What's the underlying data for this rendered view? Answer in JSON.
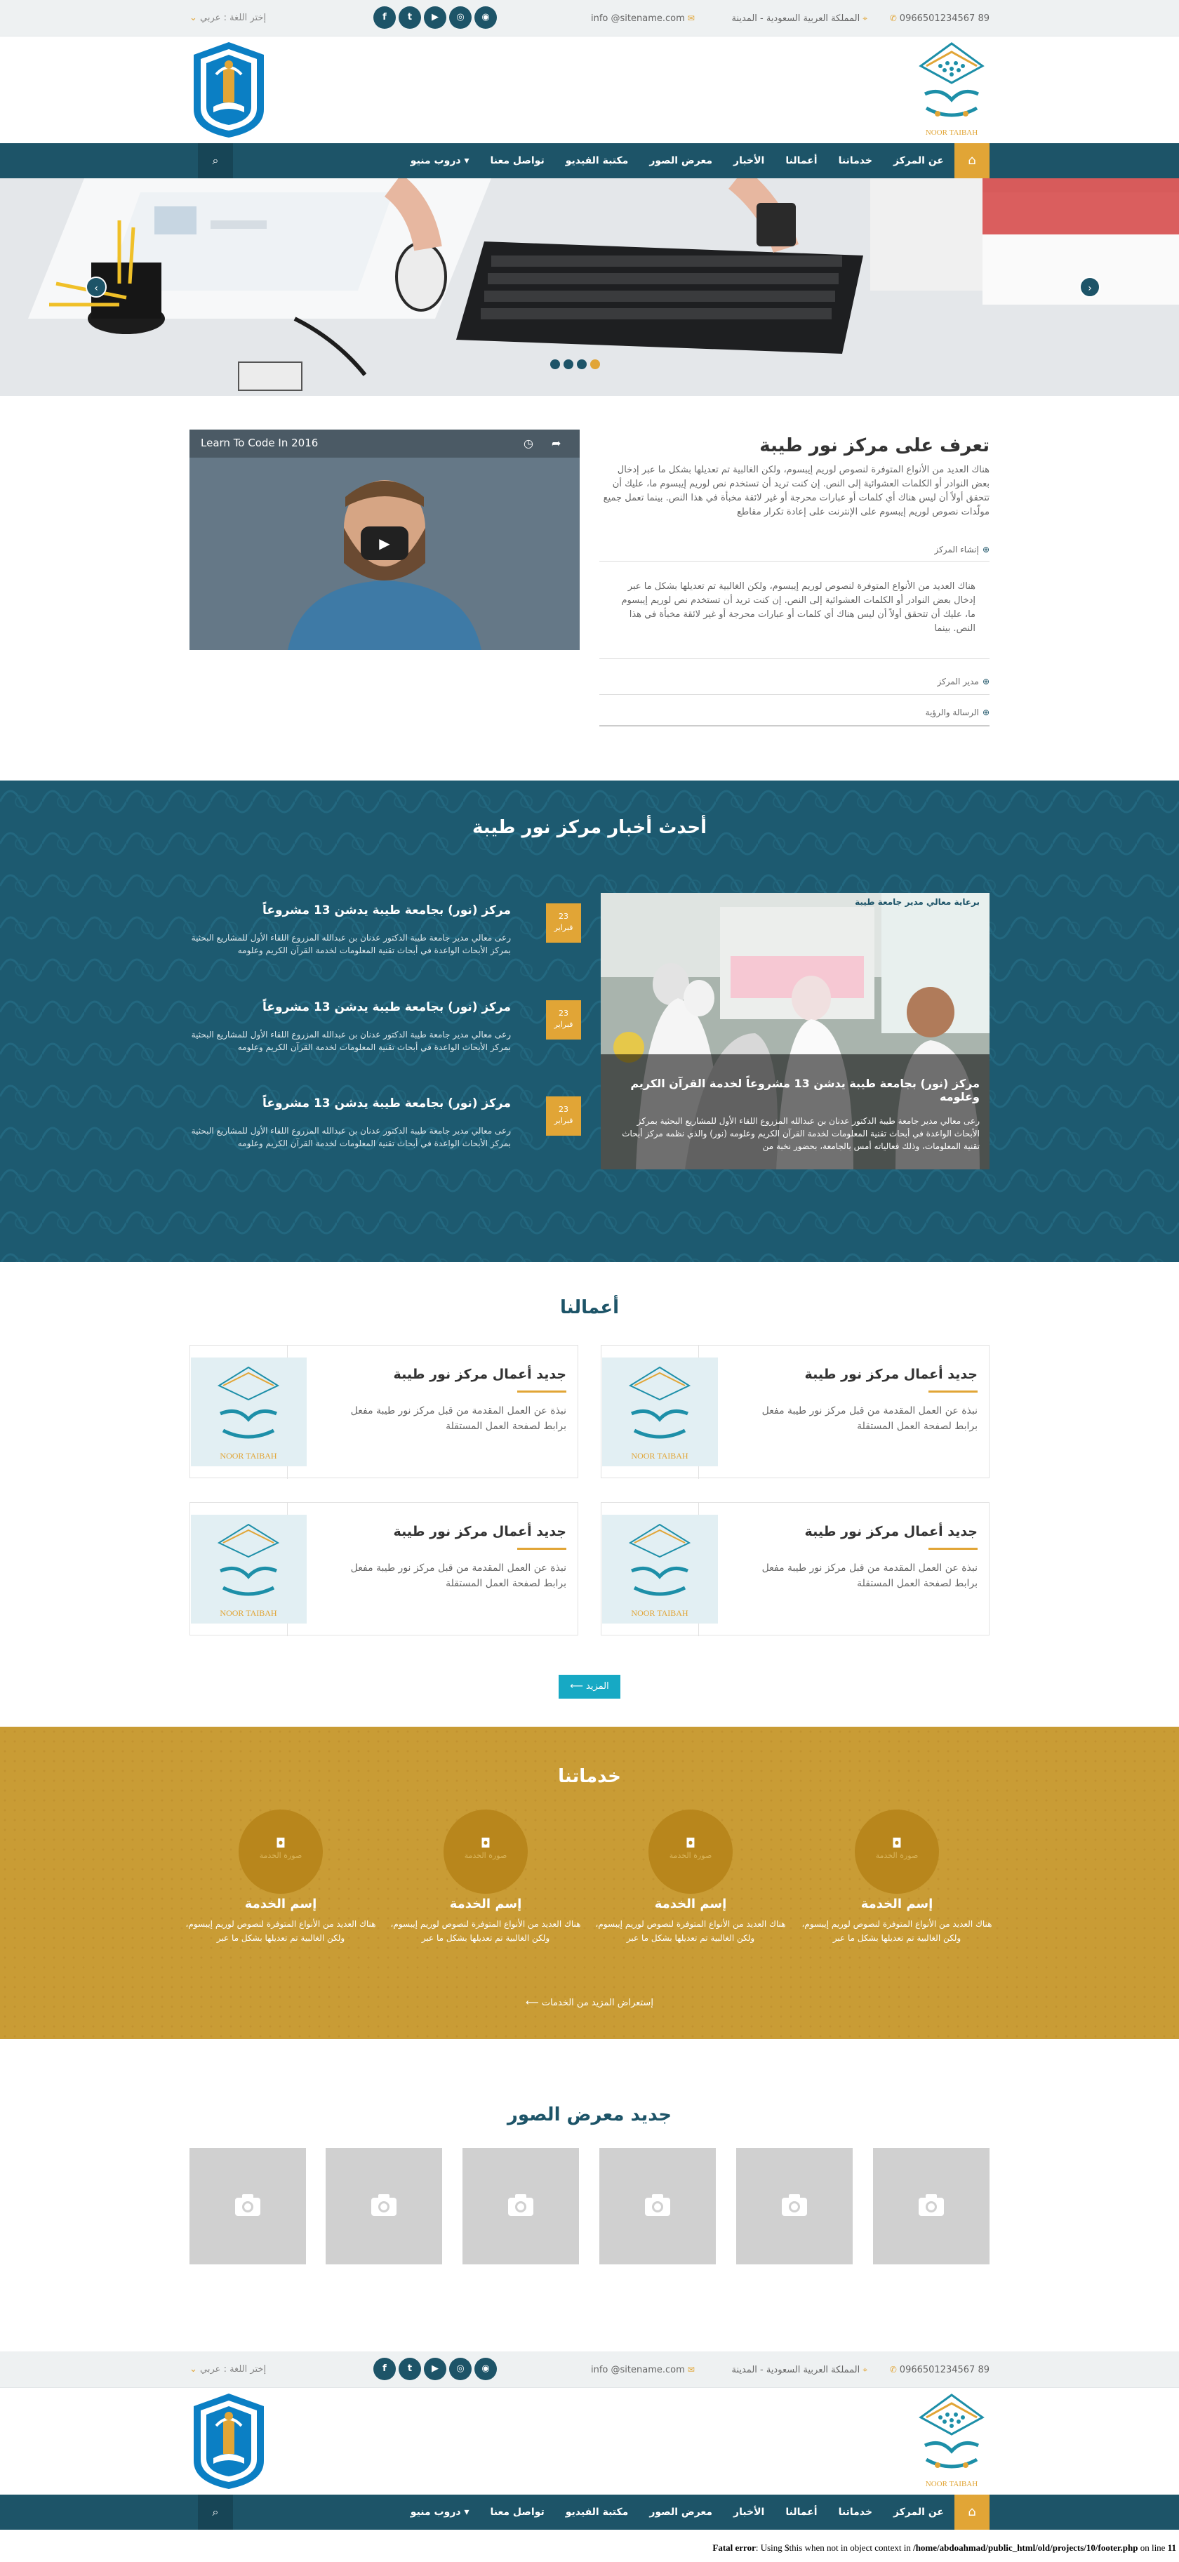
{
  "topbar": {
    "phone": "0966501234567 89",
    "address": "المملكة العربية السعودية - المدينة",
    "email": "info @sitename.com",
    "language_label": "إختر اللغة : عربي"
  },
  "social_icons": [
    "rss-icon",
    "instagram-icon",
    "youtube-icon",
    "twitter-icon",
    "facebook-icon"
  ],
  "logos": {
    "right_logo_text": "نور طيبة",
    "right_logo_caption": "NOOR TAIBAH"
  },
  "nav": {
    "items": [
      "عن المركز",
      "خدماتنا",
      "أعمالنا",
      "الأخبار",
      "معرض الصور",
      "مكتبة الفيديو",
      "تواصل معنا",
      "دروب منيو"
    ]
  },
  "about": {
    "title": "تعرف على مركز نور طيبة",
    "text": "هناك العديد من الأنواع المتوفرة لنصوص لوريم إيبسوم، ولكن الغالبية تم تعديلها بشكل ما عبر إدخال بعض النوادر أو الكلمات العشوائية إلى النص. إن كنت تريد أن تستخدم نص لوريم إيبسوم ما، عليك أن تتحقق أولاً أن ليس هناك أي كلمات أو عبارات محرجة أو غير لائقة مخبأة في هذا النص. بينما تعمل جميع مولّدات نصوص لوريم إيبسوم على الإنترنت على إعادة تكرار مقاطع",
    "accordion": [
      {
        "label": "إنشاء المركز",
        "content": "هناك العديد من الأنواع المتوفرة لنصوص لوريم إيبسوم، ولكن الغالبية تم تعديلها بشكل ما عبر إدخال بعض النوادر أو الكلمات العشوائية إلى النص. إن كنت تريد أن تستخدم نص لوريم إيبسوم ما، عليك أن تتحقق أولاً أن ليس هناك أي كلمات أو عبارات محرجة أو غير لائقة مخبأة في هذا النص. بينما"
      },
      {
        "label": "مدير المركز"
      },
      {
        "label": "الرسالة والرؤية"
      }
    ],
    "video_title": "Learn To Code In 2016"
  },
  "news": {
    "title": "أحدث أخبار مركز نور طيبة",
    "featured": {
      "title": "مركز (نور) بجامعة طيبة يدشن 13 مشروعاً لخدمة القرآن الكريم وعلومه",
      "text": "رعى معالي مدير جامعة طيبة الدكتور عدنان بن عبدالله المزروع اللقاء الأول للمشاريع البحثية بمركز الأبحاث الواعدة في أبحاث تقنية المعلومات لخدمة القرآن الكريم وعلومه (نور) والذي نظمه مركز أبحاث تقنية المعلومات، وذلك فعالياته أمس بالجامعة، بحضور نخبة من",
      "banner": "برعاية معالي مدير جامعة طيبة"
    },
    "items": [
      {
        "day": "23",
        "month": "فبراير",
        "title": "مركز (نور) بجامعة طيبة يدشن 13 مشروعاً",
        "text": "رعى معالي مدير جامعة طيبة الدكتور عدنان بن عبدالله المزروع اللقاء الأول للمشاريع البحثية بمركز الأبحاث الواعدة في أبحاث تقنية المعلومات لخدمة القرآن الكريم وعلومه"
      },
      {
        "day": "23",
        "month": "فبراير",
        "title": "مركز (نور) بجامعة طيبة يدشن 13 مشروعاً",
        "text": "رعى معالي مدير جامعة طيبة الدكتور عدنان بن عبدالله المزروع اللقاء الأول للمشاريع البحثية بمركز الأبحاث الواعدة في أبحاث تقنية المعلومات لخدمة القرآن الكريم وعلومه"
      },
      {
        "day": "23",
        "month": "فبراير",
        "title": "مركز (نور) بجامعة طيبة يدشن 13 مشروعاً",
        "text": "رعى معالي مدير جامعة طيبة الدكتور عدنان بن عبدالله المزروع اللقاء الأول للمشاريع البحثية بمركز الأبحاث الواعدة في أبحاث تقنية المعلومات لخدمة القرآن الكريم وعلومه"
      }
    ]
  },
  "works": {
    "title": "أعمالنا",
    "items": [
      {
        "title": "جديد أعمال مركز نور طيبة",
        "text": "نبذة عن العمل المقدمة من قبل مركز نور طيبة مفعل برابط لصفحة العمل المستقلة"
      },
      {
        "title": "جديد أعمال مركز نور طيبة",
        "text": "نبذة عن العمل المقدمة من قبل مركز نور طيبة مفعل برابط لصفحة العمل المستقلة"
      },
      {
        "title": "جديد أعمال مركز نور طيبة",
        "text": "نبذة عن العمل المقدمة من قبل مركز نور طيبة مفعل برابط لصفحة العمل المستقلة"
      },
      {
        "title": "جديد أعمال مركز نور طيبة",
        "text": "نبذة عن العمل المقدمة من قبل مركز نور طيبة مفعل برابط لصفحة العمل المستقلة"
      }
    ],
    "more_button": "المزيد"
  },
  "services": {
    "title": "خدماتنا",
    "items": [
      {
        "circle_label": "صورة الخدمة",
        "name": "إسم الخدمة",
        "text": "هناك العديد من الأنواع المتوفرة لنصوص لوريم إيبسوم، ولكن الغالبية تم تعديلها بشكل ما عبر"
      },
      {
        "circle_label": "صورة الخدمة",
        "name": "إسم الخدمة",
        "text": "هناك العديد من الأنواع المتوفرة لنصوص لوريم إيبسوم، ولكن الغالبية تم تعديلها بشكل ما عبر"
      },
      {
        "circle_label": "صورة الخدمة",
        "name": "إسم الخدمة",
        "text": "هناك العديد من الأنواع المتوفرة لنصوص لوريم إيبسوم، ولكن الغالبية تم تعديلها بشكل ما عبر"
      },
      {
        "circle_label": "صورة الخدمة",
        "name": "إسم الخدمة",
        "text": "هناك العديد من الأنواع المتوفرة لنصوص لوريم إيبسوم، ولكن الغالبية تم تعديلها بشكل ما عبر"
      }
    ],
    "more_link": "إستعراض المزيد من الخدمات"
  },
  "gallery": {
    "title": "جديد معرض الصور",
    "count": 6
  },
  "error": {
    "prefix": "Fatal error",
    "message": ": Using $this when not in object context in",
    "path": "/home/abdoahmad/public_html/old/projects/10/footer.php",
    "line_text": "on line",
    "line": "11"
  },
  "colors": {
    "primary": "#1d5468",
    "accent": "#e1a536",
    "services_bg": "#c99c35"
  }
}
